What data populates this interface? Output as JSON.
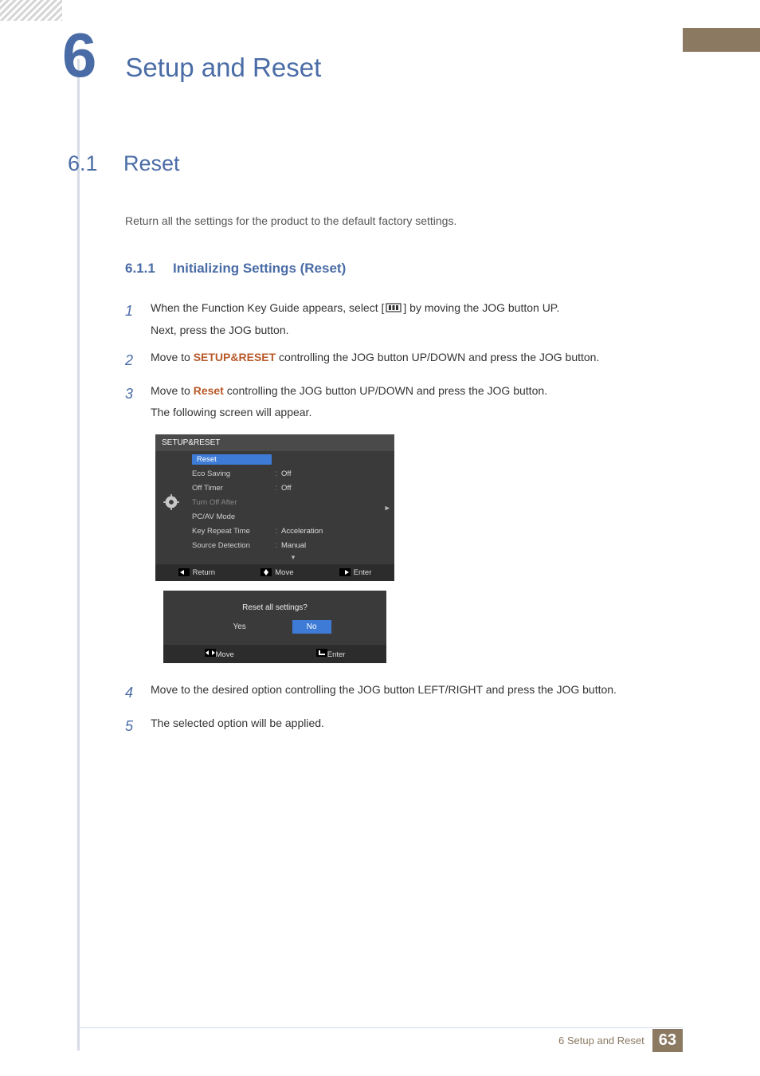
{
  "chapter": {
    "num": "6",
    "title": "Setup and Reset"
  },
  "section": {
    "num": "6.1",
    "title": "Reset"
  },
  "intro": "Return all the settings for the product to the default factory settings.",
  "subsection": {
    "num": "6.1.1",
    "title": "Initializing Settings (Reset)"
  },
  "steps": {
    "s1a": "When the Function Key Guide appears, select [",
    "s1b": "] by moving the JOG button UP.",
    "s1c": "Next, press the JOG button.",
    "s2a": "Move to ",
    "s2kw": "SETUP&RESET",
    "s2b": " controlling the JOG button UP/DOWN and press the JOG button.",
    "s3a": "Move to ",
    "s3kw": "Reset",
    "s3b": " controlling the JOG button UP/DOWN and press the JOG button.",
    "s3c": "The following screen will appear.",
    "s4": "Move to the desired option controlling the JOG button LEFT/RIGHT and press the JOG button.",
    "s5": "The selected option will be applied."
  },
  "nums": {
    "n1": "1",
    "n2": "2",
    "n3": "3",
    "n4": "4",
    "n5": "5"
  },
  "osd": {
    "title": "SETUP&RESET",
    "rows": [
      {
        "label": "Reset",
        "value": "",
        "sel": true
      },
      {
        "label": "Eco Saving",
        "value": "Off"
      },
      {
        "label": "Off Timer",
        "value": "Off"
      },
      {
        "label": "Turn Off After",
        "value": "",
        "dim": true
      },
      {
        "label": "PC/AV Mode",
        "value": ""
      },
      {
        "label": "Key Repeat Time",
        "value": "Acceleration"
      },
      {
        "label": "Source Detection",
        "value": "Manual"
      }
    ],
    "footer": {
      "return": "Return",
      "move": "Move",
      "enter": "Enter"
    }
  },
  "dialog": {
    "question": "Reset all settings?",
    "yes": "Yes",
    "no": "No",
    "footer": {
      "move": "Move",
      "enter": "Enter"
    }
  },
  "pagefoot": {
    "label": "6 Setup and Reset",
    "page": "63"
  }
}
